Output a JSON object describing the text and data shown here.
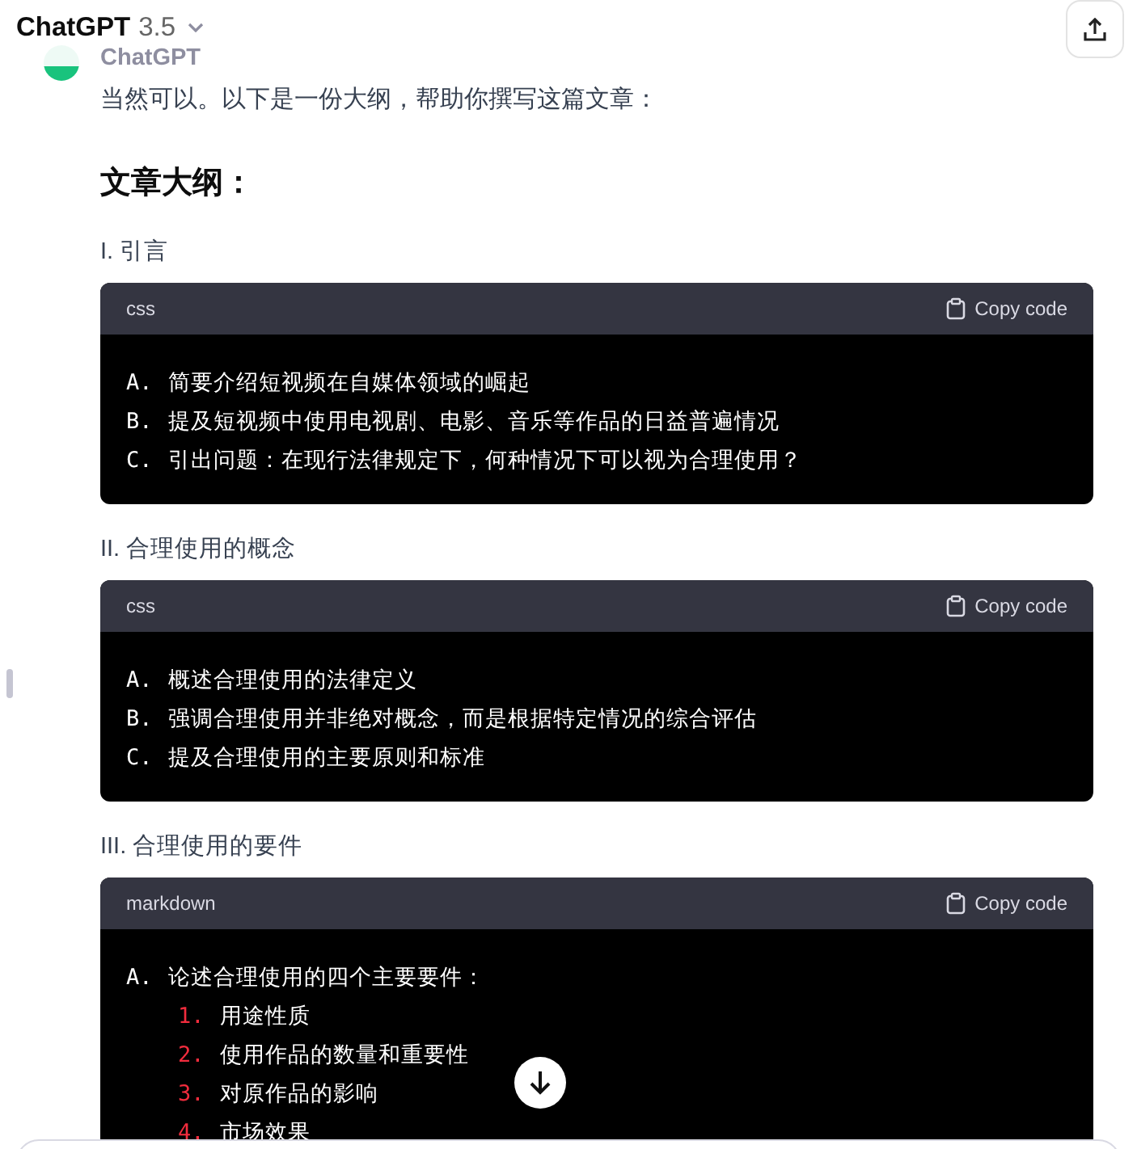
{
  "header": {
    "title": "ChatGPT",
    "version": "3.5"
  },
  "message": {
    "author": "ChatGPT",
    "intro": "当然可以。以下是一份大纲，帮助你撰写这篇文章：",
    "heading": "文章大纲：",
    "sections": [
      {
        "title": "I. 引言",
        "code": {
          "language": "css",
          "copy_label": "Copy code",
          "lines": [
            {
              "marker": "A.",
              "text": "简要介绍短视频在自媒体领域的崛起"
            },
            {
              "marker": "B.",
              "text": "提及短视频中使用电视剧、电影、音乐等作品的日益普遍情况"
            },
            {
              "marker": "C.",
              "text": "引出问题：在现行法律规定下，何种情况下可以视为合理使用？"
            }
          ]
        }
      },
      {
        "title": "II. 合理使用的概念",
        "code": {
          "language": "css",
          "copy_label": "Copy code",
          "lines": [
            {
              "marker": "A.",
              "text": "概述合理使用的法律定义"
            },
            {
              "marker": "B.",
              "text": "强调合理使用并非绝对概念，而是根据特定情况的综合评估"
            },
            {
              "marker": "C.",
              "text": "提及合理使用的主要原则和标准"
            }
          ]
        }
      },
      {
        "title": "III. 合理使用的要件",
        "code": {
          "language": "markdown",
          "copy_label": "Copy code",
          "lines": [
            {
              "marker": "A.",
              "text": "论述合理使用的四个主要要件：",
              "children": [
                {
                  "marker": "1.",
                  "text": "用途性质"
                },
                {
                  "marker": "2.",
                  "text": "使用作品的数量和重要性"
                },
                {
                  "marker": "3.",
                  "text": "对原作品的影响"
                },
                {
                  "marker": "4.",
                  "text": "市场效果"
                }
              ]
            }
          ]
        }
      }
    ]
  }
}
